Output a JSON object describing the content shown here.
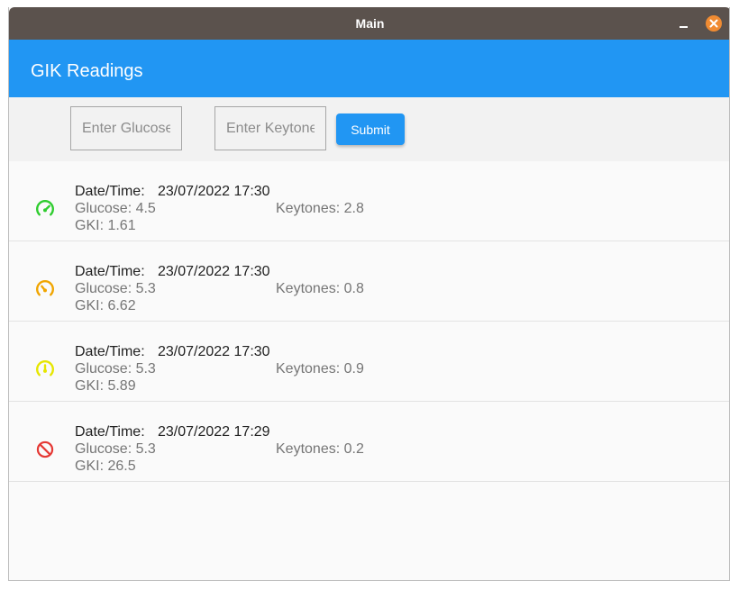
{
  "window": {
    "title": "Main"
  },
  "appbar": {
    "title": "GIK Readings"
  },
  "form": {
    "glucose_placeholder": "Enter Glucose",
    "keytones_placeholder": "Enter Keytones",
    "submit_label": "Submit"
  },
  "colors": {
    "accent": "#2196f3",
    "titlebar": "#5b524d",
    "close": "#f08b32",
    "good": "#2ecc2e",
    "moderate": "#f0a500",
    "mild": "#e6e600",
    "bad": "#e53935"
  },
  "readings": [
    {
      "datetime_label": "Date/Time:",
      "datetime": "23/07/2022 17:30",
      "glucose": "Glucose: 4.5",
      "keytones": "Keytones: 2.8",
      "gki": "GKI: 1.61",
      "icon": "speedometer-high-icon",
      "icon_color": "#2ecc2e"
    },
    {
      "datetime_label": "Date/Time:",
      "datetime": "23/07/2022 17:30",
      "glucose": "Glucose: 5.3",
      "keytones": "Keytones: 0.8",
      "gki": "GKI: 6.62",
      "icon": "speedometer-medium-icon",
      "icon_color": "#f0a500"
    },
    {
      "datetime_label": "Date/Time:",
      "datetime": "23/07/2022 17:30",
      "glucose": "Glucose: 5.3",
      "keytones": "Keytones: 0.9",
      "gki": "GKI: 5.89",
      "icon": "speedometer-slow-icon",
      "icon_color": "#e6e600"
    },
    {
      "datetime_label": "Date/Time:",
      "datetime": "23/07/2022 17:29",
      "glucose": "Glucose: 5.3",
      "keytones": "Keytones: 0.2",
      "gki": "GKI: 26.5",
      "icon": "block-icon",
      "icon_color": "#e53935"
    }
  ]
}
